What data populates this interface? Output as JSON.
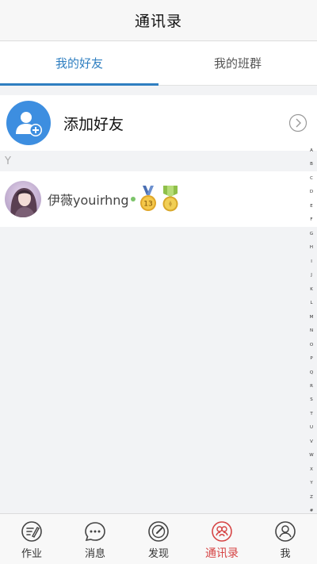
{
  "header": {
    "title": "通讯录"
  },
  "tabs": [
    {
      "label": "我的好友",
      "active": true
    },
    {
      "label": "我的班群",
      "active": false
    }
  ],
  "add_friend": {
    "label": "添加好友"
  },
  "section": {
    "letter": "Y"
  },
  "friends": [
    {
      "name": "伊薇youirhng",
      "medal_level": "13"
    }
  ],
  "index_letters": [
    "A",
    "B",
    "C",
    "D",
    "E",
    "F",
    "G",
    "H",
    "I",
    "J",
    "K",
    "L",
    "M",
    "N",
    "O",
    "P",
    "Q",
    "R",
    "S",
    "T",
    "U",
    "V",
    "W",
    "X",
    "Y",
    "Z",
    "#"
  ],
  "bottom_nav": [
    {
      "label": "作业",
      "icon": "homework-icon",
      "active": false
    },
    {
      "label": "消息",
      "icon": "message-icon",
      "active": false
    },
    {
      "label": "发现",
      "icon": "discover-icon",
      "active": false
    },
    {
      "label": "通讯录",
      "icon": "contacts-icon",
      "active": true
    },
    {
      "label": "我",
      "icon": "profile-icon",
      "active": false
    }
  ],
  "colors": {
    "accent_blue": "#2f7fc1",
    "active_red": "#d64545",
    "add_avatar_blue": "#3d8ee0"
  }
}
